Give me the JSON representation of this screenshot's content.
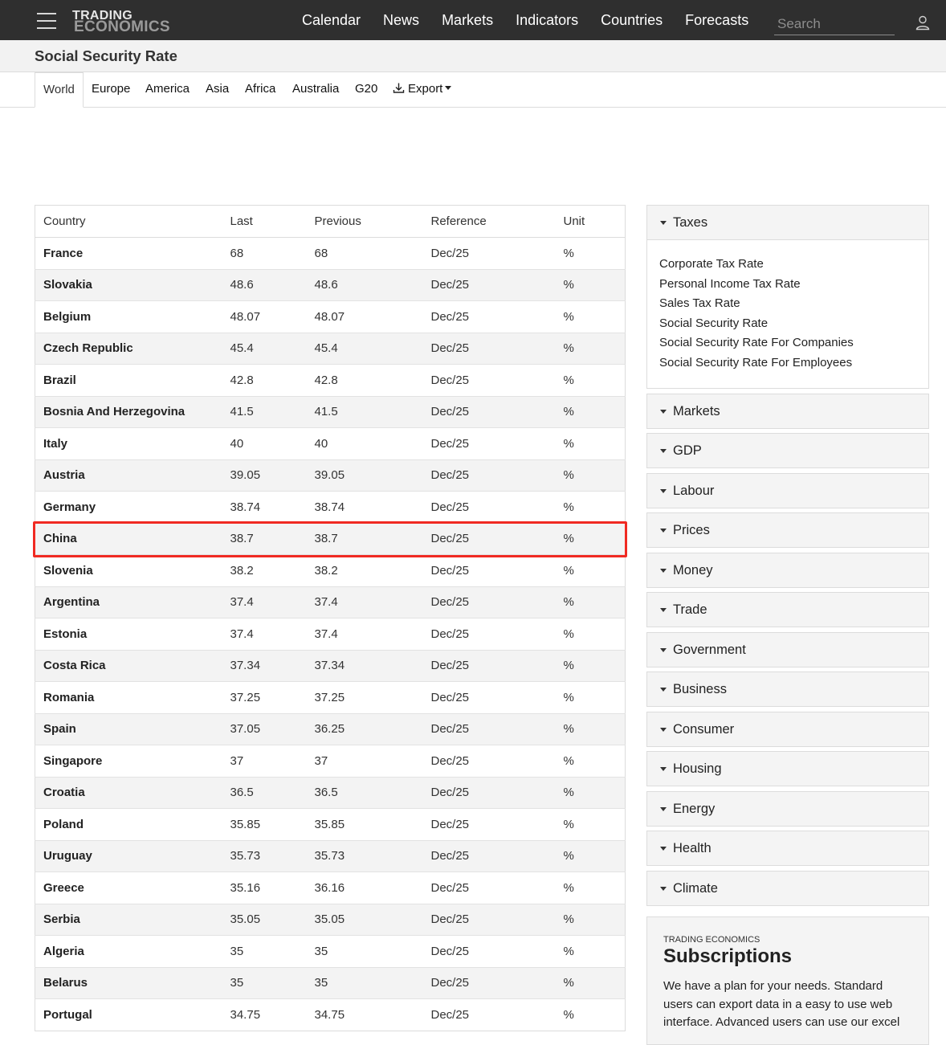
{
  "header": {
    "logo_line1": "TRADING",
    "logo_line2": "ECONOMICS",
    "nav": [
      "Calendar",
      "News",
      "Markets",
      "Indicators",
      "Countries",
      "Forecasts"
    ],
    "search_placeholder": "Search"
  },
  "page": {
    "title": "Social Security Rate"
  },
  "tabs": {
    "items": [
      "World",
      "Europe",
      "America",
      "Asia",
      "Africa",
      "Australia",
      "G20"
    ],
    "active": "World",
    "export_label": "Export"
  },
  "table": {
    "columns": [
      "Country",
      "Last",
      "Previous",
      "Reference",
      "Unit"
    ],
    "highlighted_row": "China",
    "rows": [
      [
        "France",
        "68",
        "68",
        "Dec/25",
        "%"
      ],
      [
        "Slovakia",
        "48.6",
        "48.6",
        "Dec/25",
        "%"
      ],
      [
        "Belgium",
        "48.07",
        "48.07",
        "Dec/25",
        "%"
      ],
      [
        "Czech Republic",
        "45.4",
        "45.4",
        "Dec/25",
        "%"
      ],
      [
        "Brazil",
        "42.8",
        "42.8",
        "Dec/25",
        "%"
      ],
      [
        "Bosnia And Herzegovina",
        "41.5",
        "41.5",
        "Dec/25",
        "%"
      ],
      [
        "Italy",
        "40",
        "40",
        "Dec/25",
        "%"
      ],
      [
        "Austria",
        "39.05",
        "39.05",
        "Dec/25",
        "%"
      ],
      [
        "Germany",
        "38.74",
        "38.74",
        "Dec/25",
        "%"
      ],
      [
        "China",
        "38.7",
        "38.7",
        "Dec/25",
        "%"
      ],
      [
        "Slovenia",
        "38.2",
        "38.2",
        "Dec/25",
        "%"
      ],
      [
        "Argentina",
        "37.4",
        "37.4",
        "Dec/25",
        "%"
      ],
      [
        "Estonia",
        "37.4",
        "37.4",
        "Dec/25",
        "%"
      ],
      [
        "Costa Rica",
        "37.34",
        "37.34",
        "Dec/25",
        "%"
      ],
      [
        "Romania",
        "37.25",
        "37.25",
        "Dec/25",
        "%"
      ],
      [
        "Spain",
        "37.05",
        "36.25",
        "Dec/25",
        "%"
      ],
      [
        "Singapore",
        "37",
        "37",
        "Dec/25",
        "%"
      ],
      [
        "Croatia",
        "36.5",
        "36.5",
        "Dec/25",
        "%"
      ],
      [
        "Poland",
        "35.85",
        "35.85",
        "Dec/25",
        "%"
      ],
      [
        "Uruguay",
        "35.73",
        "35.73",
        "Dec/25",
        "%"
      ],
      [
        "Greece",
        "35.16",
        "36.16",
        "Dec/25",
        "%"
      ],
      [
        "Serbia",
        "35.05",
        "35.05",
        "Dec/25",
        "%"
      ],
      [
        "Algeria",
        "35",
        "35",
        "Dec/25",
        "%"
      ],
      [
        "Belarus",
        "35",
        "35",
        "Dec/25",
        "%"
      ],
      [
        "Portugal",
        "34.75",
        "34.75",
        "Dec/25",
        "%"
      ]
    ]
  },
  "sidebar": {
    "open_panel": {
      "title": "Taxes",
      "links": [
        "Corporate Tax Rate",
        "Personal Income Tax Rate",
        "Sales Tax Rate",
        "Social Security Rate",
        "Social Security Rate For Companies",
        "Social Security Rate For Employees"
      ]
    },
    "collapsed_panels": [
      "Markets",
      "GDP",
      "Labour",
      "Prices",
      "Money",
      "Trade",
      "Government",
      "Business",
      "Consumer",
      "Housing",
      "Energy",
      "Health",
      "Climate"
    ]
  },
  "subscriptions": {
    "brand": "TRADING ECONOMICS",
    "heading": "Subscriptions",
    "text": "We have a plan for your needs. Standard users can export data in a easy to use web interface. Advanced users can use our excel"
  },
  "colors": {
    "navbar": "#2f2f2f",
    "highlight": "#f02a22",
    "row_alt": "#f3f3f3"
  },
  "icons": [
    "hamburger-icon",
    "user-icon",
    "download-icon",
    "caret-down-icon"
  ]
}
